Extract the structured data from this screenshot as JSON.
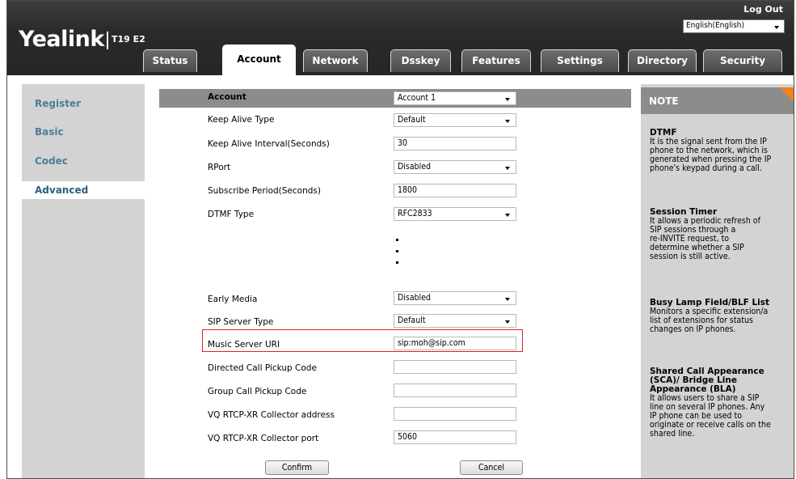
{
  "header": {
    "brand": "Yealink",
    "model": "T19 E2",
    "logout": "Log Out",
    "language": "English(English)"
  },
  "tabs": [
    "Status",
    "Account",
    "Network",
    "Dsskey",
    "Features",
    "Settings",
    "Directory",
    "Security"
  ],
  "active_tab": "Account",
  "sidebar": {
    "items": [
      "Register",
      "Basic",
      "Codec",
      "Advanced"
    ],
    "active": "Advanced"
  },
  "form": {
    "account_label": "Account",
    "account_value": "Account 1",
    "rows": [
      {
        "label": "Keep Alive Type",
        "value": "Default"
      },
      {
        "label": "Keep Alive Interval(Seconds)",
        "value": "30"
      },
      {
        "label": "RPort",
        "value": "Disabled"
      },
      {
        "label": "Subscribe Period(Seconds)",
        "value": "1800"
      },
      {
        "label": "DTMF Type",
        "value": "RFC2833"
      },
      {
        "label": "Early Media",
        "value": "Disabled"
      },
      {
        "label": "SIP Server Type",
        "value": "Default"
      },
      {
        "label": "Music Server URI",
        "value": "sip:moh@sip.com"
      },
      {
        "label": "Directed Call Pickup Code",
        "value": ""
      },
      {
        "label": "Group Call Pickup Code",
        "value": ""
      },
      {
        "label": "VQ RTCP-XR Collector address",
        "value": ""
      },
      {
        "label": "VQ RTCP-XR Collector port",
        "value": "5060"
      }
    ],
    "confirm": "Confirm",
    "cancel": "Cancel"
  },
  "note": {
    "header": "NOTE",
    "sections": [
      {
        "title": "DTMF",
        "text": [
          "It is the signal sent from the IP",
          "phone to the network, which is",
          "generated when pressing the IP",
          "phone's keypad during a call."
        ]
      },
      {
        "title": "Session Timer",
        "text": [
          "It allows a periodic refresh of",
          "SIP sessions through a",
          "re-INVITE request, to",
          "determine whether a SIP",
          "session is still active."
        ]
      },
      {
        "title": "Busy Lamp Field/BLF List",
        "text": [
          "Monitors a specific extension/a",
          "list of extensions for status",
          "changes on IP phones."
        ]
      },
      {
        "title_lines": [
          "Shared Call Appearance",
          "(SCA)/ Bridge Line",
          "Appearance (BLA)"
        ],
        "text": [
          "It allows users to share a SIP",
          "line on several IP phones. Any",
          "IP phone can be used to",
          "originate or receive calls on the",
          "shared line."
        ]
      }
    ]
  },
  "colors": {
    "header_bg": "#2a2a2a",
    "panel_gray": "#d3d3d3",
    "bar_gray": "#8c8c8c",
    "highlight_red": "#e02020",
    "note_corner_orange": "#f0821e",
    "sidebar_link": "#4a7f9a"
  }
}
